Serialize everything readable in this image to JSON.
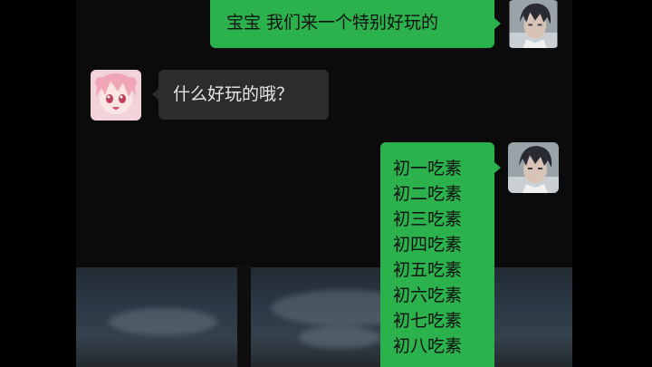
{
  "messages": [
    {
      "sender": "me",
      "text": "宝宝 我们来一个特别好玩的",
      "avatar": "male-anime-avatar-icon"
    },
    {
      "sender": "other",
      "text": "什么好玩的哦？",
      "avatar": "pink-hair-anime-avatar-icon"
    },
    {
      "sender": "me",
      "avatar": "male-anime-avatar-icon",
      "lines": [
        "初一吃素",
        "初二吃素",
        "初三吃素",
        "初四吃素",
        "初五吃素",
        "初六吃素",
        "初七吃素",
        "初八吃素"
      ]
    }
  ],
  "colors": {
    "me_bubble": "#2bb24c",
    "other_bubble": "#2c2c2c",
    "background": "#0b0b0b"
  }
}
